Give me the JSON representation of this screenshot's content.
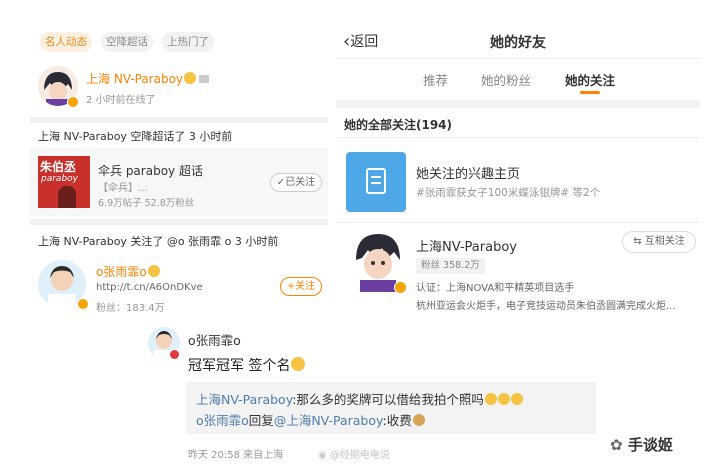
{
  "left": {
    "tabs": [
      {
        "label": "名人动态",
        "active": true
      },
      {
        "label": "空降超话",
        "active": false
      },
      {
        "label": "上热门了",
        "active": false
      }
    ],
    "profile": {
      "name": "上海 NV-Paraboy",
      "status": "2 小时前在线了"
    },
    "activity1": {
      "header": "上海 NV-Paraboy 空降超话了 3 小时前",
      "card_title": "伞兵 paraboy 超话",
      "card_sub": "【伞兵】...",
      "card_stats": "6.9万帖子  52.8万粉丝",
      "follow_label": "已关注",
      "thumb_text1": "朱伯丞",
      "thumb_text2": "paraboy"
    },
    "activity2": {
      "header": "上海 NV-Paraboy 关注了 @o 张雨霏 o 3 小时前",
      "name": "o张雨霏o",
      "link": "http://t.cn/A6OnDKve",
      "fans": "粉丝：183.4万",
      "follow_label": "+关注"
    }
  },
  "right": {
    "back_label": "返回",
    "title": "她的好友",
    "tabs": [
      {
        "label": "推荐",
        "active": false
      },
      {
        "label": "她的粉丝",
        "active": false
      },
      {
        "label": "她的关注",
        "active": true
      }
    ],
    "all_follow": "她的全部关注(194)",
    "interest": {
      "title": "她关注的兴趣主页",
      "sub": "#张雨霏获女子100米蝶泳银牌# 等2个"
    },
    "user": {
      "name": "上海NV-Paraboy",
      "fans_label": "粉丝",
      "fans": "358.2万",
      "cert": "认证：上海NOVA和平精英项目选手",
      "desc": "杭州亚运会火炬手，电子竞技运动员朱伯丞圆满完成火炬...",
      "mutual_label": "互相关注"
    }
  },
  "comment": {
    "author": "o张雨霏o",
    "text": "冠军冠军 签个名",
    "reply1_user": "上海NV-Paraboy",
    "reply1_text": ":那么多的奖牌可以借给我拍个照吗",
    "reply2_user": "o张雨霏o",
    "reply2_mid": "回复",
    "reply2_target": "@上海NV-Paraboy",
    "reply2_text": ":收费",
    "meta": "昨天 20:58 来自上海"
  },
  "watermarks": {
    "weibo": "@经期电电说",
    "brand": "手谈姬"
  },
  "colors": {
    "accent": "#ff8200",
    "link": "#507daf",
    "verified": "#f7a400"
  }
}
